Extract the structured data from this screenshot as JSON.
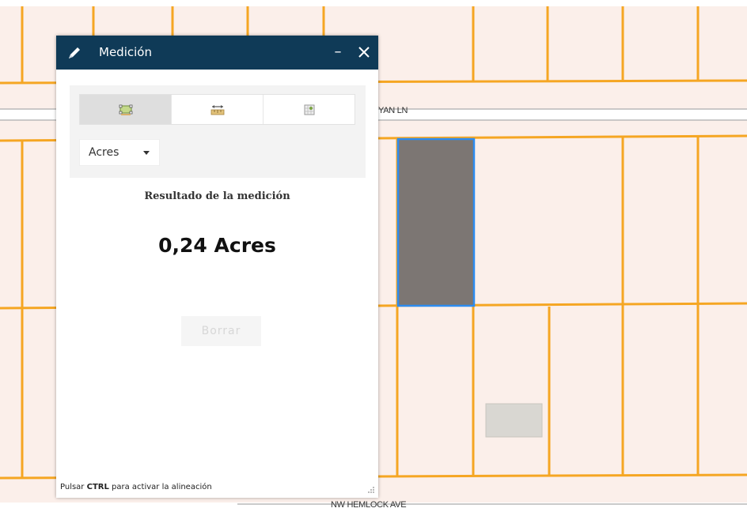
{
  "map": {
    "background_color": "#fbefea",
    "parcel_line_color": "#f5a623",
    "selected_parcel_fill": "#7c7673",
    "selected_parcel_outline": "#2d8cf0",
    "street_labels": {
      "top": "YAN LN",
      "bottom": "NW HEMLOCK AVE"
    }
  },
  "widget": {
    "title": "Medición",
    "header_color": "#0f3a57",
    "icons": {
      "title": "pencil-icon",
      "minimize": "minimize-icon",
      "close": "close-icon"
    },
    "minimize_label": "–",
    "tools": [
      {
        "name": "area-tool",
        "icon": "area-measure-icon",
        "active": true
      },
      {
        "name": "distance-tool",
        "icon": "distance-measure-icon",
        "active": false
      },
      {
        "name": "location-tool",
        "icon": "location-measure-icon",
        "active": false
      }
    ],
    "unit_select": {
      "selected": "Acres"
    },
    "result_heading": "Resultado de la medición",
    "result_value": "0,24 Acres",
    "clear_button_label": "Borrar",
    "hint": {
      "prefix": "Pulsar ",
      "key": "CTRL",
      "suffix": " para activar la alineación"
    }
  }
}
